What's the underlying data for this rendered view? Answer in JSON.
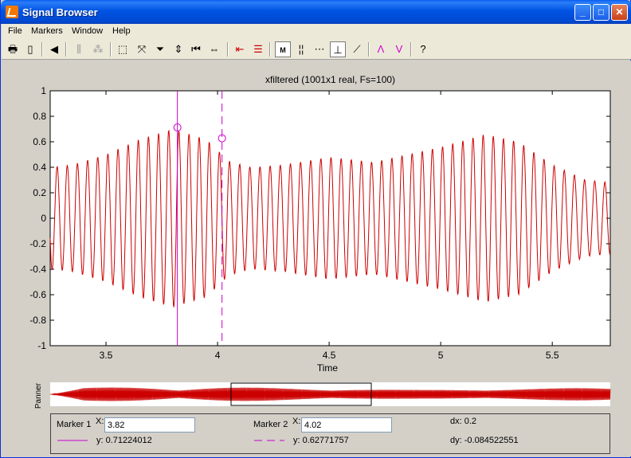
{
  "window": {
    "title": "Signal Browser"
  },
  "menu": [
    "File",
    "Markers",
    "Window",
    "Help"
  ],
  "plot": {
    "title": "xfiltered (1001x1 real, Fs=100)",
    "x_label": "Time",
    "panner_label": "Panner",
    "line_color": "#cc0000",
    "marker_color": "#cc00cc"
  },
  "markers": {
    "marker1": {
      "label": "Marker 1",
      "x_label": "X:",
      "x_value": "3.82",
      "y_text": "y: 0.71224012"
    },
    "marker2": {
      "label": "Marker 2",
      "x_label": "X:",
      "x_value": "4.02",
      "y_text": "y: 0.62771757"
    },
    "dx_text": "dx: 0.2",
    "dy_text": "dy: -0.084522551"
  },
  "chart_data": {
    "type": "line",
    "title": "xfiltered (1001x1 real, Fs=100)",
    "xlabel": "Time",
    "ylabel": "",
    "xlim": [
      3.25,
      5.76
    ],
    "ylim": [
      -1,
      1
    ],
    "xticks": [
      "3.5",
      "4",
      "4.5",
      "5",
      "5.5"
    ],
    "yticks": [
      "1",
      "0.8",
      "0.6",
      "0.4",
      "0.2",
      "0",
      "-0.2",
      "-0.4",
      "-0.6",
      "-0.8",
      "-1"
    ],
    "envelope": {
      "t": [
        3.25,
        3.35,
        3.5,
        3.65,
        3.8,
        3.95,
        4.05,
        4.15,
        4.3,
        4.5,
        4.7,
        4.85,
        5.0,
        5.2,
        5.35,
        5.5,
        5.65,
        5.76
      ],
      "amplitude": [
        0.4,
        0.42,
        0.5,
        0.62,
        0.7,
        0.62,
        0.45,
        0.4,
        0.42,
        0.48,
        0.44,
        0.5,
        0.56,
        0.66,
        0.6,
        0.42,
        0.3,
        0.28
      ]
    },
    "approx_frequency_hz": 22,
    "markers": [
      {
        "x": 3.82,
        "y": 0.71224012,
        "style": "solid"
      },
      {
        "x": 4.02,
        "y": 0.62771757,
        "style": "dashed"
      }
    ],
    "panner_range": [
      4.32,
      4.7
    ]
  }
}
